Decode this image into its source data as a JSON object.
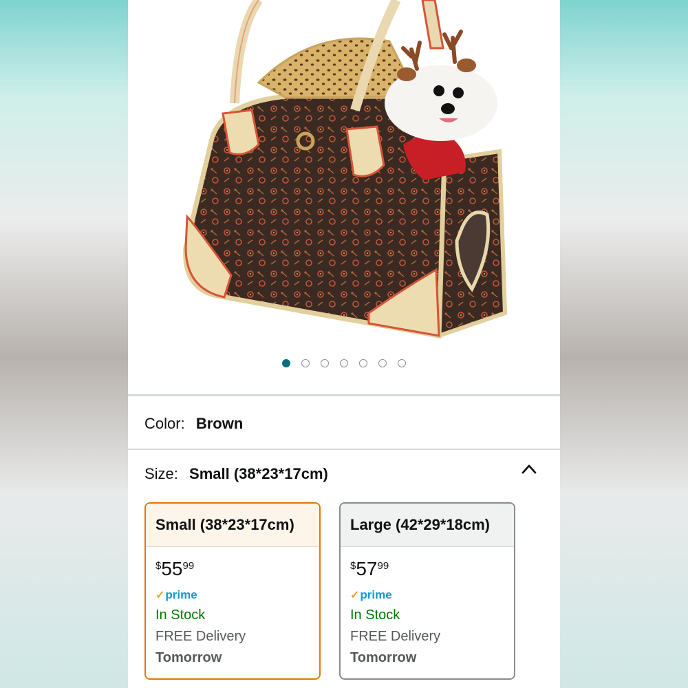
{
  "gallery": {
    "image_count": 7,
    "active_index": 0,
    "image_alt": "dog-in-carrier-bag"
  },
  "color": {
    "label": "Color:",
    "value": "Brown"
  },
  "size": {
    "label": "Size:",
    "value": "Small (38*23*17cm)",
    "expanded": true,
    "options": [
      {
        "name": "Small (38*23*17cm)",
        "price_symbol": "$",
        "price_whole": "55",
        "price_fraction": "99",
        "prime": "prime",
        "stock": "In Stock",
        "delivery": "FREE Delivery",
        "delivery_day": "Tomorrow",
        "selected": true
      },
      {
        "name": "Large (42*29*18cm)",
        "price_symbol": "$",
        "price_whole": "57",
        "price_fraction": "99",
        "prime": "prime",
        "stock": "In Stock",
        "delivery": "FREE Delivery",
        "delivery_day": "Tomorrow",
        "selected": false
      }
    ]
  },
  "colors": {
    "selected_border": "#e77600",
    "in_stock": "#007600",
    "prime_blue": "#1399d6",
    "dot_active": "#0b6e7f"
  }
}
